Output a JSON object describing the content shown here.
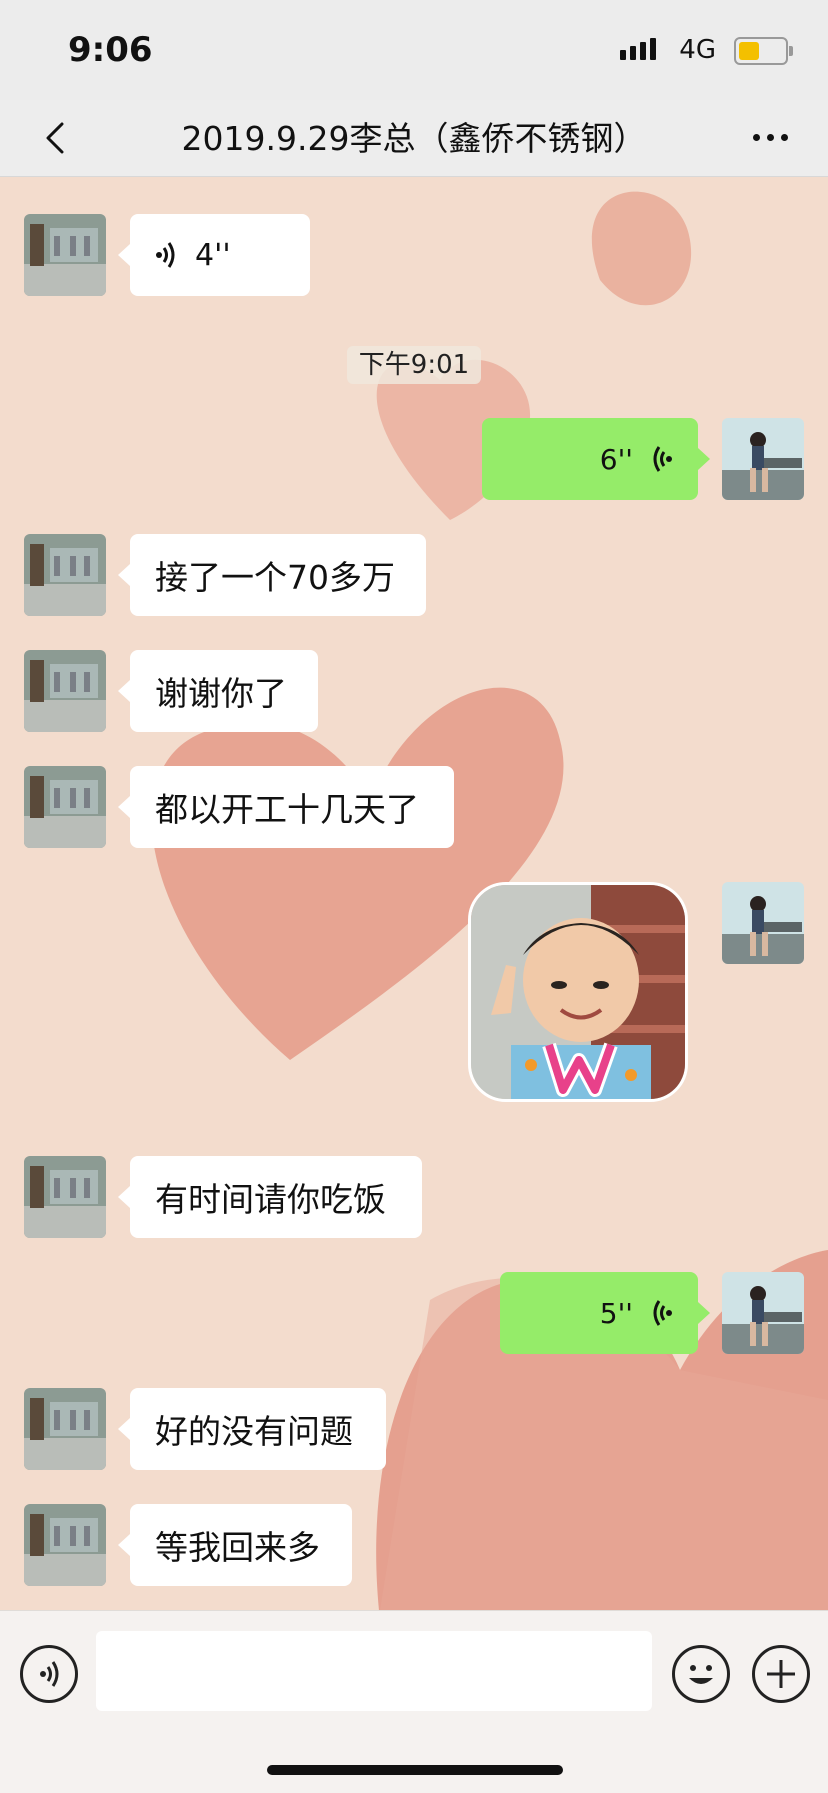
{
  "status_bar": {
    "time": "9:06",
    "network": "4G"
  },
  "nav": {
    "title": "2019.9.29李总（鑫侨不锈钢）"
  },
  "messages": [
    {
      "type": "voice_in",
      "duration": "4''"
    },
    {
      "type": "timestamp",
      "text": "下午9:01"
    },
    {
      "type": "voice_out",
      "duration": "6''"
    },
    {
      "type": "text_in",
      "text": "接了一个70多万"
    },
    {
      "type": "text_in",
      "text": "谢谢你了"
    },
    {
      "type": "text_in",
      "text": "都以开工十几天了"
    },
    {
      "type": "sticker_out"
    },
    {
      "type": "text_in",
      "text": "有时间请你吃饭"
    },
    {
      "type": "voice_out",
      "duration": "5''"
    },
    {
      "type": "text_in",
      "text": "好的没有问题"
    },
    {
      "type": "text_in",
      "text": "等我回来多"
    }
  ],
  "icons": {
    "back": "chevron-left-icon",
    "more": "more-dots-icon",
    "voice_mode": "voice-mode-icon",
    "emoji": "emoji-icon",
    "plus": "plus-icon"
  },
  "colors": {
    "outgoing_bubble": "#95ec69",
    "incoming_bubble": "#ffffff",
    "battery": "#f4c000"
  }
}
